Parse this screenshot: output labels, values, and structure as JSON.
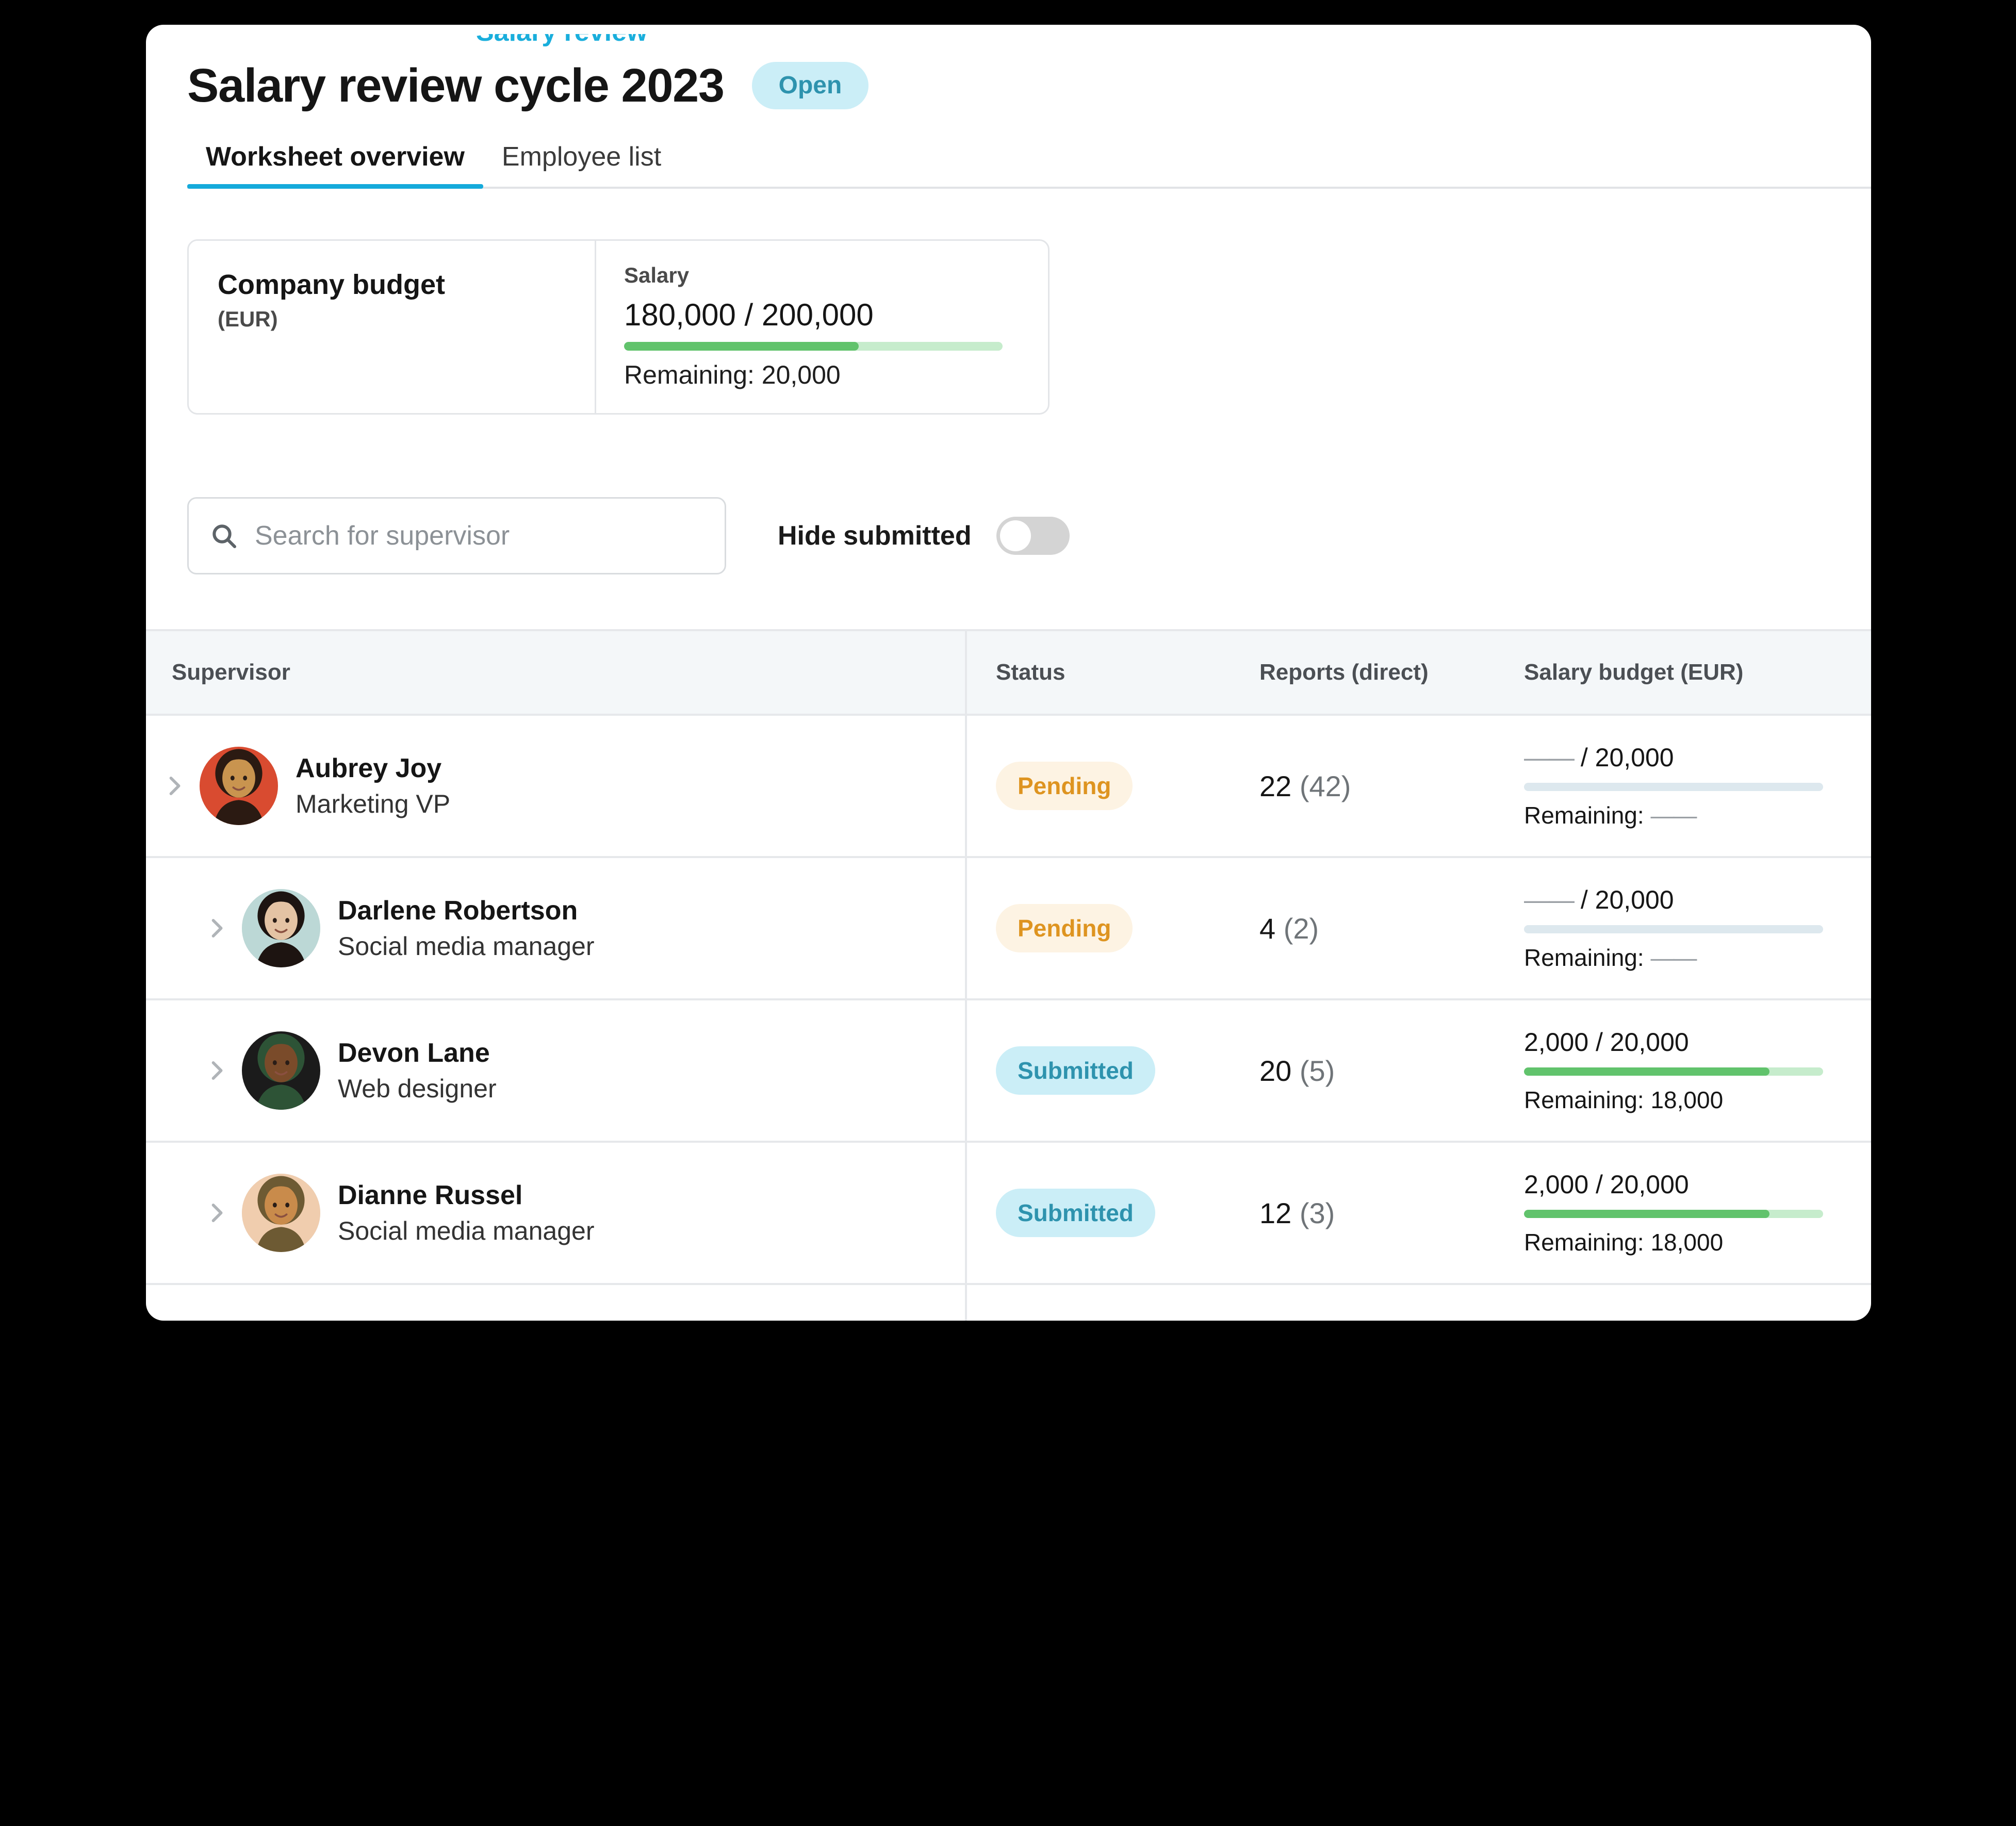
{
  "breadcrumb": {
    "clipped_text": "Salary review"
  },
  "header": {
    "title": "Salary review cycle 2023",
    "status_pill": "Open",
    "status_pill_bg": "#CBEEF7",
    "status_pill_fg": "#2E93AE"
  },
  "tabs": [
    {
      "label": "Worksheet overview",
      "active": true
    },
    {
      "label": "Employee list",
      "active": false
    }
  ],
  "budget_card": {
    "title": "Company budget",
    "currency": "(EUR)",
    "metric_label": "Salary",
    "amount": "180,000 / 200,000",
    "spent": 180000,
    "total": 200000,
    "bar_percent": 62,
    "bar_fill_color": "#61C36C",
    "bar_track_color": "#C6ECCC",
    "remaining": "Remaining: 20,000"
  },
  "filters": {
    "search_placeholder": "Search for supervisor",
    "search_value": "",
    "search_icon": "search-icon",
    "toggle_label": "Hide submitted",
    "toggle_on": false
  },
  "table": {
    "columns": [
      "Supervisor",
      "Status",
      "Reports (direct)",
      "Salary budget (EUR)"
    ],
    "rows": [
      {
        "name": "Aubrey Joy",
        "role": "Marketing VP",
        "indent": false,
        "avatar_colors": [
          "#2b1a12",
          "#c9944f",
          "#d94b30"
        ],
        "status": "Pending",
        "status_kind": "pending",
        "reports_main": "22",
        "reports_paren": "(42)",
        "budget_amount_prefix": "——",
        "budget_amount_suffix": " / 20,000",
        "budget_bar_percent": 0,
        "budget_bar_kind": "empty",
        "remaining_label": "Remaining: ",
        "remaining_value": "——"
      },
      {
        "name": "Darlene Robertson",
        "role": "Social media manager",
        "indent": true,
        "avatar_colors": [
          "#1d1411",
          "#e4c3a4",
          "#bcd8d6"
        ],
        "status": "Pending",
        "status_kind": "pending",
        "reports_main": "4",
        "reports_paren": "(2)",
        "budget_amount_prefix": "——",
        "budget_amount_suffix": " / 20,000",
        "budget_bar_percent": 0,
        "budget_bar_kind": "empty",
        "remaining_label": "Remaining: ",
        "remaining_value": "——"
      },
      {
        "name": "Devon Lane",
        "role": "Web designer",
        "indent": true,
        "avatar_colors": [
          "#2d5336",
          "#7a4b2a",
          "#1b1b1b"
        ],
        "status": "Submitted",
        "status_kind": "submitted",
        "reports_main": "20",
        "reports_paren": "(5)",
        "budget_amount_prefix": "2,000",
        "budget_amount_suffix": " / 20,000",
        "budget_bar_percent": 82,
        "budget_bar_kind": "filled",
        "remaining_label": "Remaining: 18,000",
        "remaining_value": ""
      },
      {
        "name": "Dianne Russel",
        "role": "Social media manager",
        "indent": true,
        "avatar_colors": [
          "#6d5a33",
          "#c98b4b",
          "#f0cdae"
        ],
        "status": "Submitted",
        "status_kind": "submitted",
        "reports_main": "12",
        "reports_paren": "(3)",
        "budget_amount_prefix": "2,000",
        "budget_amount_suffix": " / 20,000",
        "budget_bar_percent": 82,
        "budget_bar_kind": "filled",
        "remaining_label": "Remaining: 18,000",
        "remaining_value": ""
      }
    ]
  }
}
